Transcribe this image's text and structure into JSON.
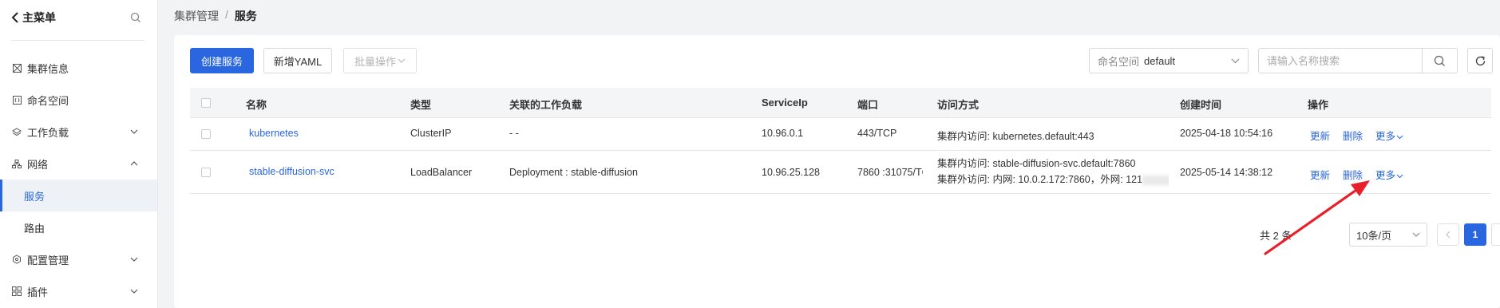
{
  "sidebar": {
    "title": "主菜单",
    "items": [
      {
        "label": "集群信息",
        "icon": "cluster-icon"
      },
      {
        "label": "命名空间",
        "icon": "namespace-icon"
      },
      {
        "label": "工作负载",
        "icon": "workload-icon"
      },
      {
        "label": "网络",
        "icon": "network-icon"
      },
      {
        "label": "服务"
      },
      {
        "label": "路由"
      },
      {
        "label": "配置管理",
        "icon": "config-icon"
      },
      {
        "label": "插件",
        "icon": "plugin-icon"
      }
    ]
  },
  "breadcrumb": {
    "parent": "集群管理",
    "sep": "/",
    "current": "服务"
  },
  "toolbar": {
    "create": "创建服务",
    "add_yaml": "新增YAML",
    "batch": "批量操作",
    "namespace_label": "命名空间",
    "namespace_value": "default",
    "search_placeholder": "请输入名称搜索"
  },
  "table": {
    "headers": {
      "name": "名称",
      "type": "类型",
      "workload": "关联的工作负载",
      "ip": "ServiceIp",
      "port": "端口",
      "access": "访问方式",
      "created": "创建时间",
      "ops": "操作"
    },
    "rows": [
      {
        "name": "kubernetes",
        "type": "ClusterIP",
        "workload": "- -",
        "ip": "10.96.0.1",
        "port": "443/TCP",
        "access1": "集群内访问: kubernetes.default:443",
        "created": "2025-04-18 10:54:16"
      },
      {
        "name": "stable-diffusion-svc",
        "type": "LoadBalancer",
        "workload": "Deployment : stable-diffusion",
        "ip": "10.96.25.128",
        "port": "7860 :31075/TC",
        "access1": "集群内访问: stable-diffusion-svc.default:7860",
        "access2a": "集群外访问: 内网: 10.0.2.172:7860，外网: 121",
        "access2b": "7.",
        "created": "2025-05-14 14:38:12"
      }
    ],
    "ops": {
      "update": "更新",
      "delete": "删除",
      "more": "更多"
    }
  },
  "pagination": {
    "total": "共 2 条",
    "page_size": "10条/页",
    "current_page": "1"
  },
  "colors": {
    "primary": "#2a66e0",
    "arrow": "#e8202a"
  }
}
